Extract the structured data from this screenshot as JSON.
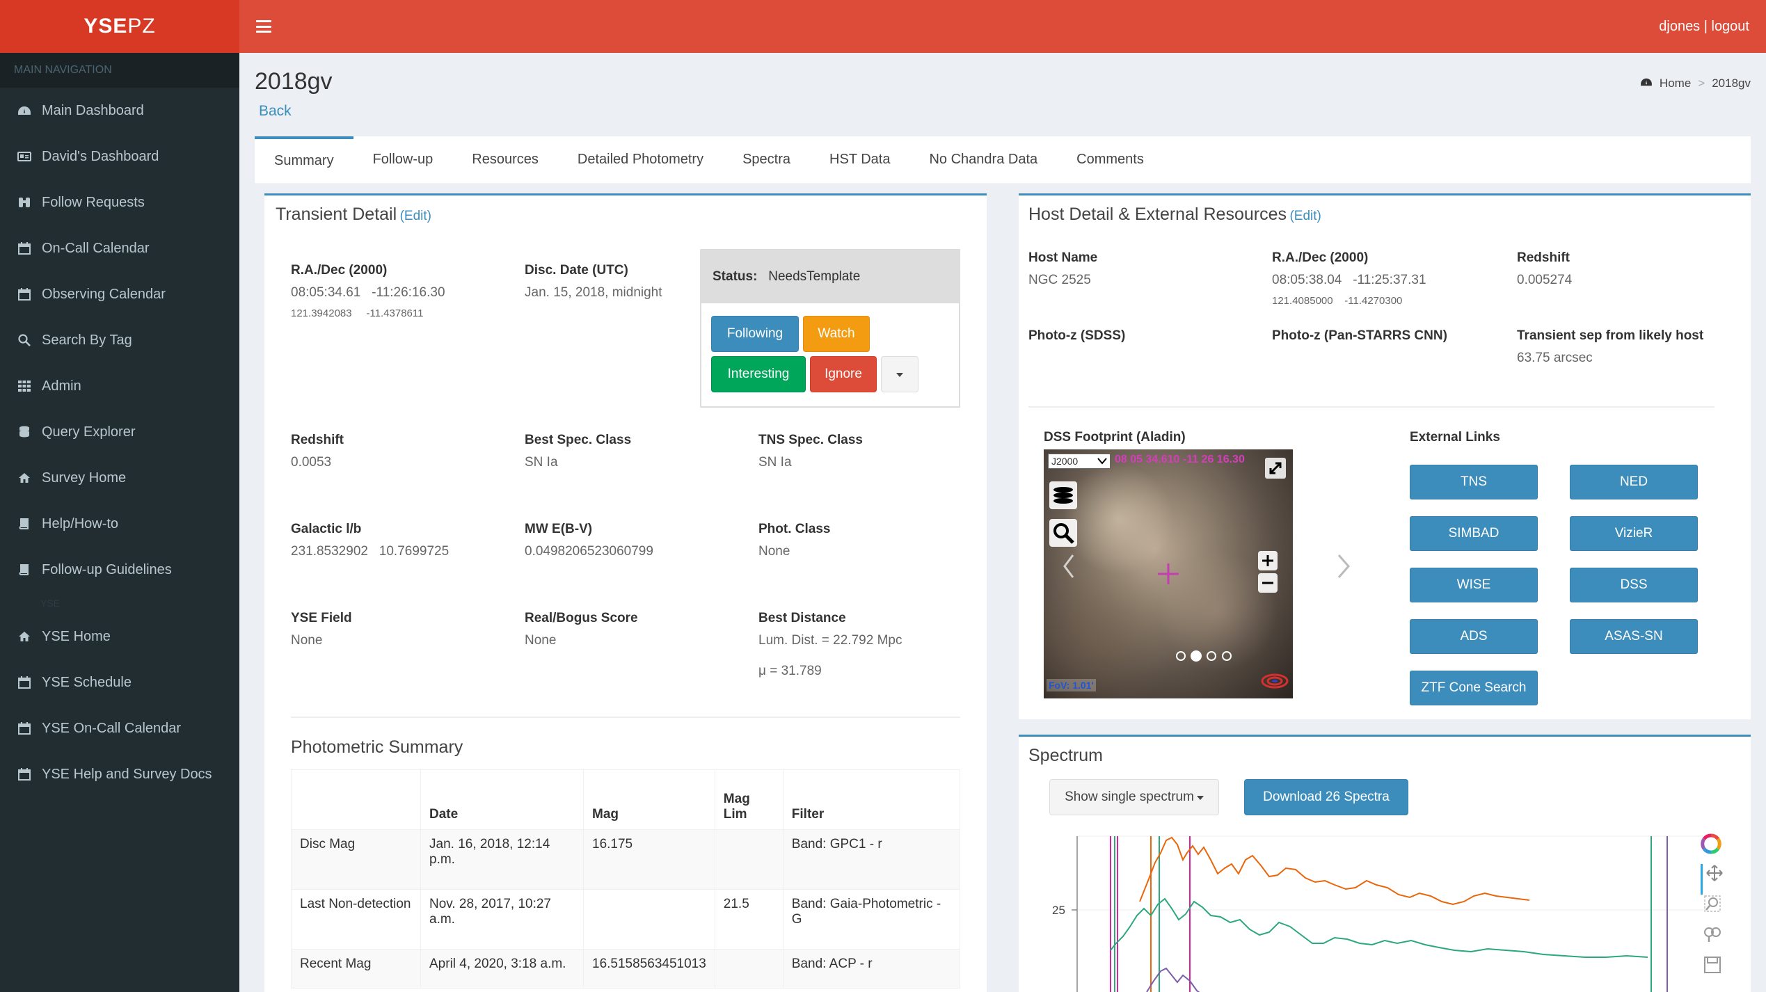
{
  "brand": {
    "bold": "YSE",
    "thin": "PZ"
  },
  "topbar": {
    "user_links": "djones | logout"
  },
  "sidebar": {
    "header": "MAIN NAVIGATION",
    "items": [
      {
        "label": "Main Dashboard",
        "icon": "dashboard-icon"
      },
      {
        "label": "David's Dashboard",
        "icon": "id-card-icon"
      },
      {
        "label": "Follow Requests",
        "icon": "binoculars-icon"
      },
      {
        "label": "On-Call Calendar",
        "icon": "calendar-icon"
      },
      {
        "label": "Observing Calendar",
        "icon": "calendar-icon"
      },
      {
        "label": "Search By Tag",
        "icon": "search-icon"
      },
      {
        "label": "Admin",
        "icon": "grid-icon"
      },
      {
        "label": "Query Explorer",
        "icon": "database-icon"
      },
      {
        "label": "Survey Home",
        "icon": "home-icon"
      },
      {
        "label": "Help/How-to",
        "icon": "book-icon"
      },
      {
        "label": "Follow-up Guidelines",
        "icon": "book-icon"
      }
    ],
    "section2": "YSE",
    "items2": [
      {
        "label": "YSE Home",
        "icon": "home-icon"
      },
      {
        "label": "YSE Schedule",
        "icon": "calendar-icon"
      },
      {
        "label": "YSE On-Call Calendar",
        "icon": "calendar-icon"
      },
      {
        "label": "YSE Help and Survey Docs",
        "icon": "calendar-icon"
      }
    ]
  },
  "page": {
    "title": "2018gv",
    "back": "Back"
  },
  "breadcrumb": {
    "home": "Home",
    "current": "2018gv"
  },
  "tabs": [
    "Summary",
    "Follow-up",
    "Resources",
    "Detailed Photometry",
    "Spectra",
    "HST Data",
    "No Chandra Data",
    "Comments"
  ],
  "transient": {
    "title": "Transient Detail",
    "edit": "(Edit)",
    "radec_label": "R.A./Dec (2000)",
    "ra": "08:05:34.61",
    "dec": "-11:26:16.30",
    "ra_deg": "121.3942083",
    "dec_deg": "-11.4378611",
    "disc_label": "Disc. Date (UTC)",
    "disc": "Jan. 15, 2018, midnight",
    "status_label": "Status:",
    "status": "NeedsTemplate",
    "btn_following": "Following",
    "btn_watch": "Watch",
    "btn_interesting": "Interesting",
    "btn_ignore": "Ignore",
    "redshift_label": "Redshift",
    "redshift": "0.0053",
    "spec_label": "Best Spec. Class",
    "spec": "SN Ia",
    "tns_label": "TNS Spec. Class",
    "tns": "SN Ia",
    "gal_label": "Galactic l/b",
    "gal_l": "231.8532902",
    "gal_b": "10.7699725",
    "mw_label": "MW E(B-V)",
    "mw": "0.0498206523060799",
    "phot_label": "Phot. Class",
    "phot": "None",
    "field_label": "YSE Field",
    "field": "None",
    "rb_label": "Real/Bogus Score",
    "rb": "None",
    "dist_label": "Best Distance",
    "dist": "Lum. Dist. = 22.792 Mpc",
    "mu": "μ = 31.789"
  },
  "photometric": {
    "title": "Photometric Summary",
    "headers": [
      "",
      "Date",
      "Mag",
      "Mag Lim",
      "Filter"
    ],
    "rows": [
      [
        "Disc Mag",
        "Jan. 16, 2018, 12:14 p.m.",
        "16.175",
        "",
        "Band: GPC1 - r"
      ],
      [
        "Last Non-detection",
        "Nov. 28, 2017, 10:27 a.m.",
        "",
        "21.5",
        "Band: Gaia-Photometric - G"
      ],
      [
        "Recent Mag",
        "April 4, 2020, 3:18 a.m.",
        "16.5158563451013",
        "",
        "Band: ACP - r"
      ]
    ]
  },
  "host": {
    "title": "Host Detail & External Resources",
    "edit": "(Edit)",
    "name_label": "Host Name",
    "name": "NGC 2525",
    "radec_label": "R.A./Dec (2000)",
    "ra": "08:05:38.04",
    "dec": "-11:25:37.31",
    "ra_deg": "121.4085000",
    "dec_deg": "-11.4270300",
    "z_label": "Redshift",
    "z": "0.005274",
    "pz_sdss_label": "Photo-z (SDSS)",
    "pz_ps_label": "Photo-z (Pan-STARRS CNN)",
    "sep_label": "Transient sep from likely host",
    "sep": "63.75 arcsec",
    "dss_label": "DSS Footprint (Aladin)",
    "aladin_frame": "J2000",
    "aladin_coords": "08 05 34.610 -11 26 16.30",
    "aladin_fov": "FoV: 1.01'",
    "ext_label": "External Links",
    "links": [
      "TNS",
      "NED",
      "SIMBAD",
      "VizieR",
      "WISE",
      "DSS",
      "ADS",
      "ASAS-SN",
      "ZTF Cone Search"
    ]
  },
  "spectrum": {
    "title": "Spectrum",
    "dropdown": "Show single spectrum",
    "download": "Download 26 Spectra",
    "ytick": "25"
  },
  "colors": {
    "red": "#dd4b39",
    "dark_red": "#d73925",
    "sidebar": "#222d32",
    "blue": "#3c8dbc",
    "orange": "#f39c12",
    "green": "#00a65a",
    "spectrum_orange": "#e8670c",
    "spectrum_green": "#2ca87b",
    "spectrum_purple": "#7b5ea7",
    "marker_magenta": "#d6249f"
  }
}
